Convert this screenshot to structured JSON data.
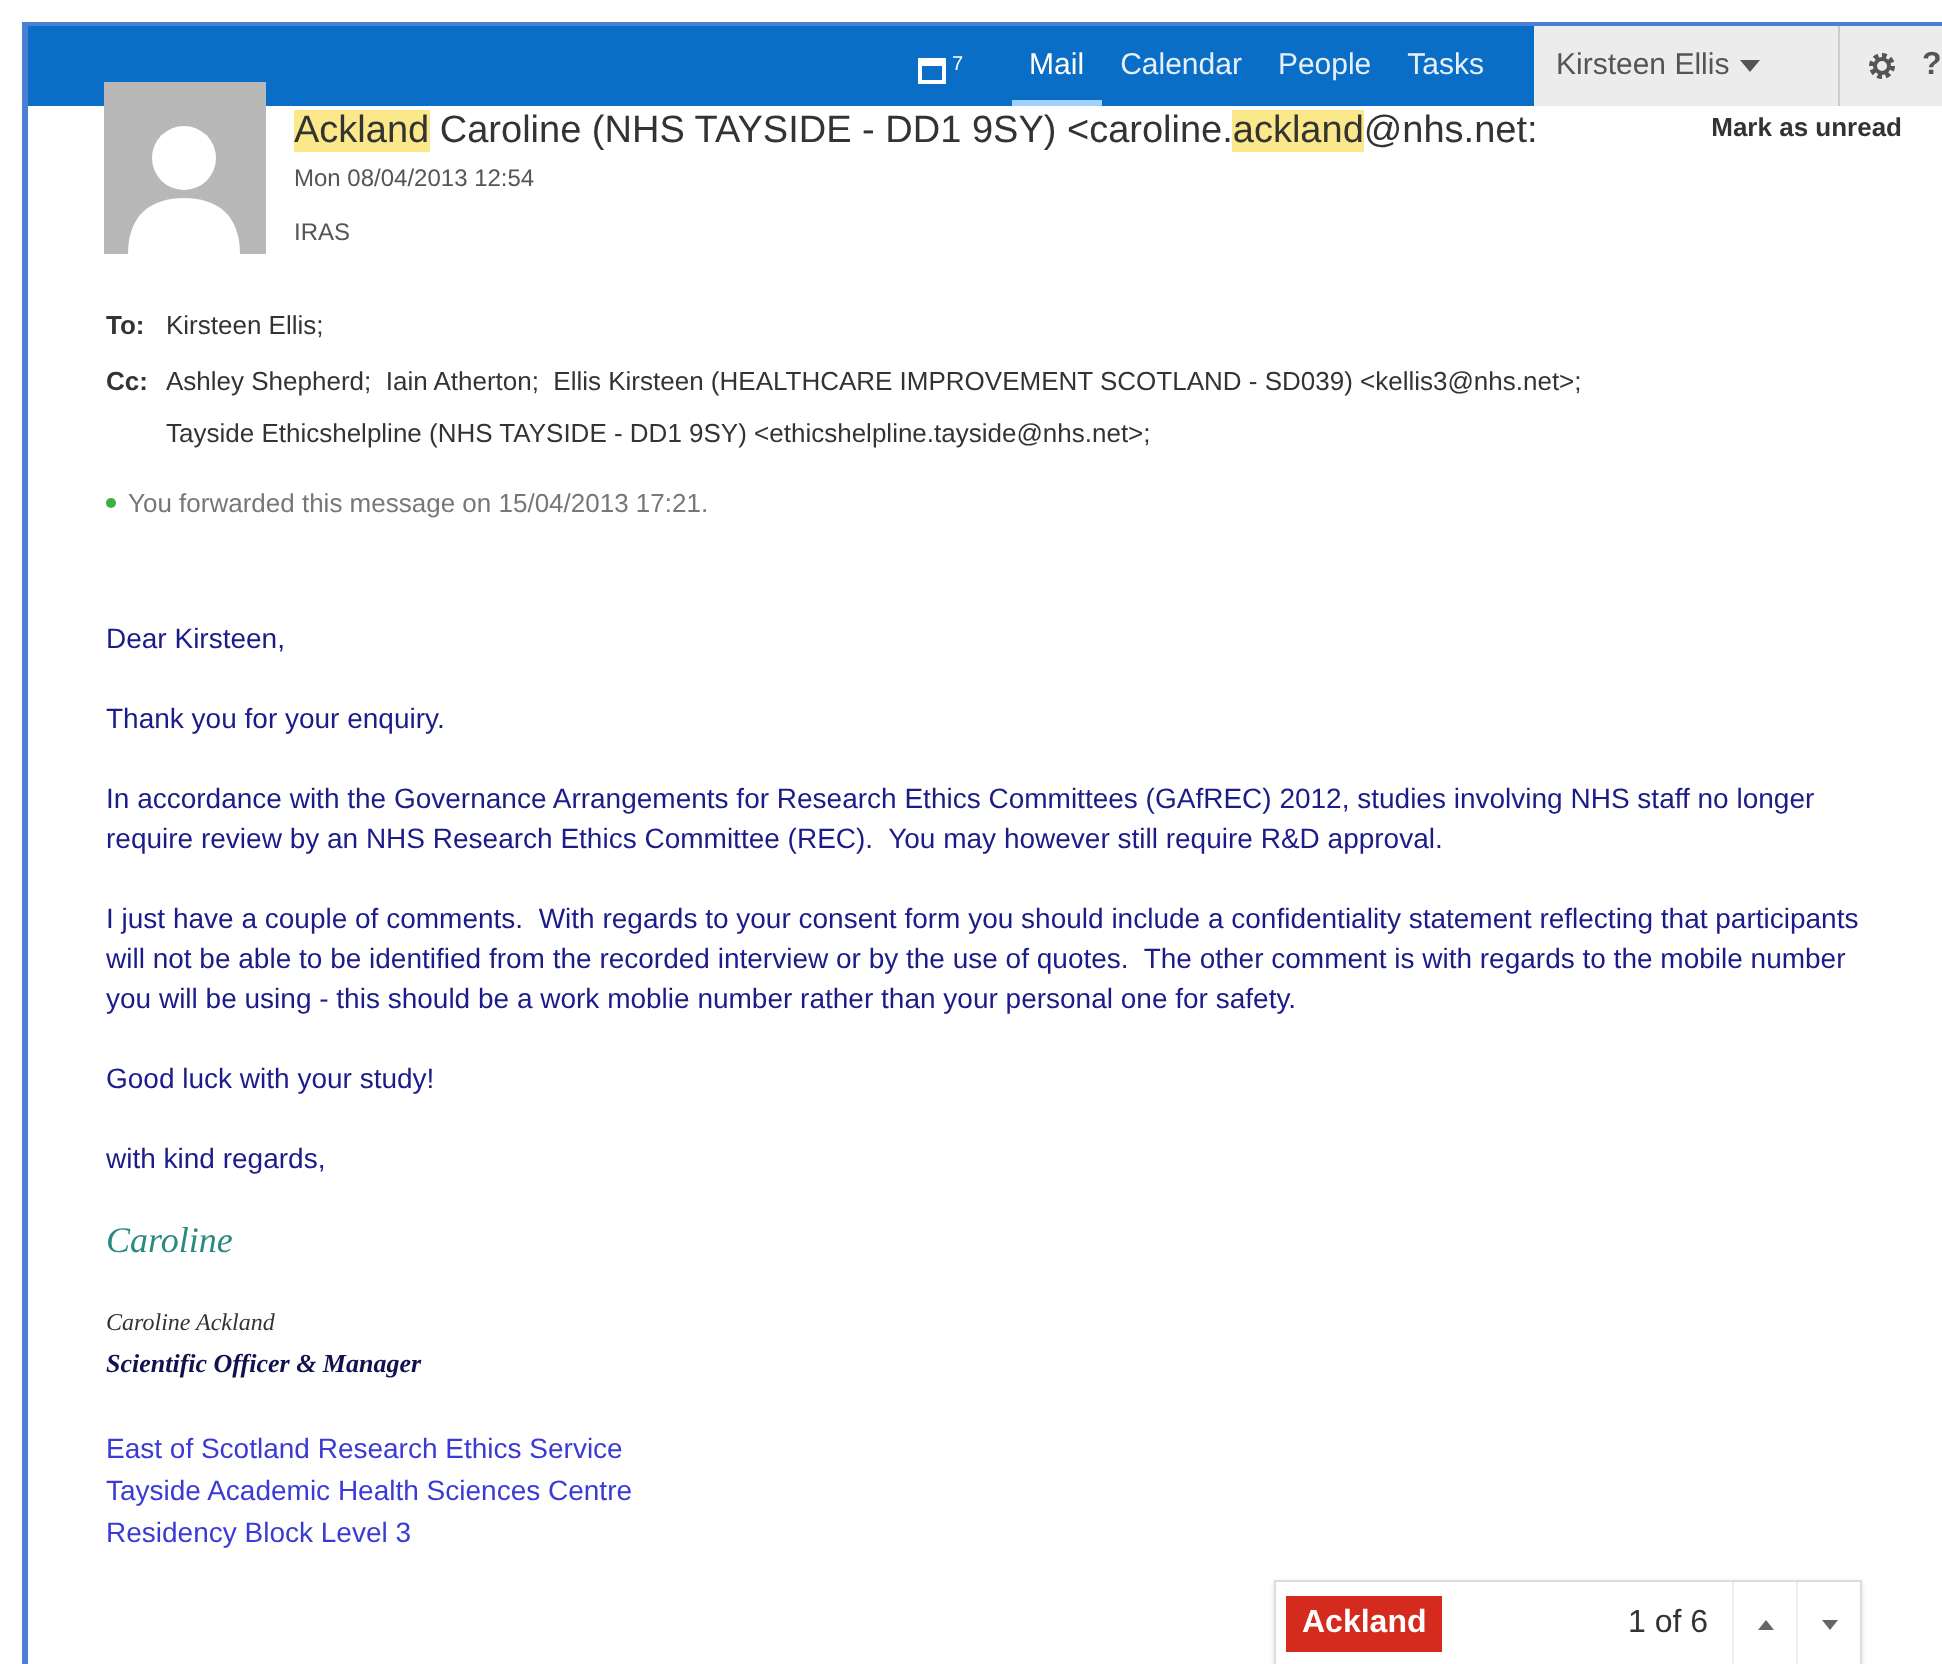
{
  "nav": {
    "calendar_badge": "7",
    "links": [
      {
        "label": "Mail",
        "selected": true
      },
      {
        "label": "Calendar",
        "selected": false
      },
      {
        "label": "People",
        "selected": false
      },
      {
        "label": "Tasks",
        "selected": false
      }
    ],
    "user": "Kirsteen Ellis",
    "help": "?"
  },
  "message": {
    "sender": [
      {
        "text": "Ackland",
        "highlighted": true
      },
      {
        "text": " Caroline (NHS TAYSIDE - DD1 9SY) <caroline.",
        "highlighted": false
      },
      {
        "text": "ackland",
        "highlighted": true
      },
      {
        "text": "@nhs.net:",
        "highlighted": false
      }
    ],
    "mark_unread": "Mark as unread",
    "date": "Mon 08/04/2013 12:54",
    "subject": "IRAS",
    "to_label": "To:",
    "to": "Kirsteen Ellis;",
    "cc_label": "Cc:",
    "cc_lines": [
      "Ashley Shepherd;  Iain Atherton;  Ellis Kirsteen (HEALTHCARE IMPROVEMENT SCOTLAND - SD039) <kellis3@nhs.net>;",
      "Tayside Ethicshelpline (NHS TAYSIDE - DD1 9SY) <ethicshelpline.tayside@nhs.net>;"
    ],
    "forwarded": "You forwarded this message on 15/04/2013 17:21."
  },
  "body": {
    "paragraphs": [
      "Dear Kirsteen,",
      "Thank you for your enquiry.",
      "In accordance with the Governance Arrangements for Research Ethics Committees (GAfREC) 2012, studies involving NHS staff no longer require review by an NHS Research Ethics Committee (REC).  You may however still require R&D approval.",
      "I just have a couple of comments.  With regards to your consent form you should include a confidentiality statement reflecting that participants will not be able to be identified from the recorded interview or by the use of quotes.  The other comment is with regards to the mobile number you will be using - this should be a work moblie number rather than your personal one for safety.",
      "Good luck with your study!",
      "with kind regards,"
    ],
    "signature": "Caroline",
    "sig_name": "Caroline Ackland",
    "sig_title": "Scientific Officer & Manager",
    "address": [
      "East of Scotland Research Ethics Service",
      "Tayside Academic Health Sciences Centre",
      "Residency Block Level 3"
    ]
  },
  "find": {
    "term": "Ackland",
    "count": "1 of 6"
  }
}
